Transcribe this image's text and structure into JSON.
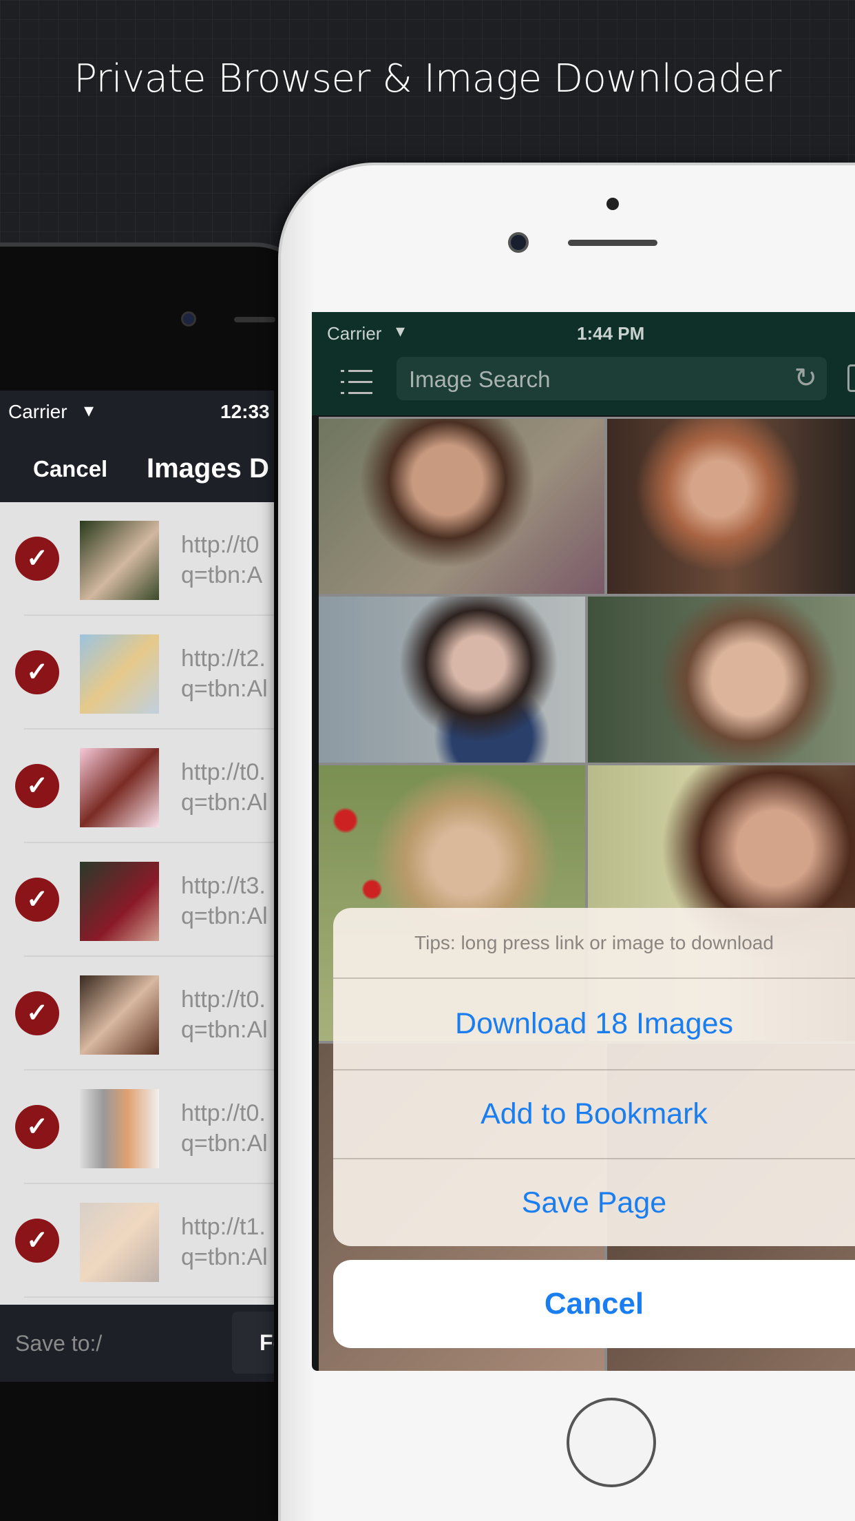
{
  "header": {
    "title": "Private Browser & Image Downloader"
  },
  "back_phone": {
    "status": {
      "carrier": "Carrier",
      "time": "12:33"
    },
    "nav": {
      "cancel_label": "Cancel",
      "title": "Images D"
    },
    "rows": [
      {
        "url1": "http://t0",
        "url2": "q=tbn:A",
        "checked": true
      },
      {
        "url1": "http://t2.",
        "url2": "q=tbn:Al",
        "checked": true
      },
      {
        "url1": "http://t0.",
        "url2": "q=tbn:Al",
        "checked": true
      },
      {
        "url1": "http://t3.",
        "url2": "q=tbn:Al",
        "checked": true
      },
      {
        "url1": "http://t0.",
        "url2": "q=tbn:Al",
        "checked": true
      },
      {
        "url1": "http://t0.",
        "url2": "q=tbn:Al",
        "checked": true
      },
      {
        "url1": "http://t1.",
        "url2": "q=tbn:Al",
        "checked": true
      }
    ],
    "bottom": {
      "save_to": "Save to:/",
      "button": "Fo"
    }
  },
  "front_phone": {
    "status": {
      "carrier": "Carrier",
      "time": "1:44 PM"
    },
    "search": {
      "placeholder": "Image Search"
    },
    "action_sheet": {
      "tip": "Tips: long press link or image to download",
      "options": [
        "Download 18 Images",
        "Add to Bookmark",
        "Save Page"
      ],
      "cancel": "Cancel"
    }
  },
  "colors": {
    "accent": "#1a7ef0",
    "check": "#8b1419",
    "toolbar": "#0f3029",
    "nav_dark": "#1d2027"
  }
}
